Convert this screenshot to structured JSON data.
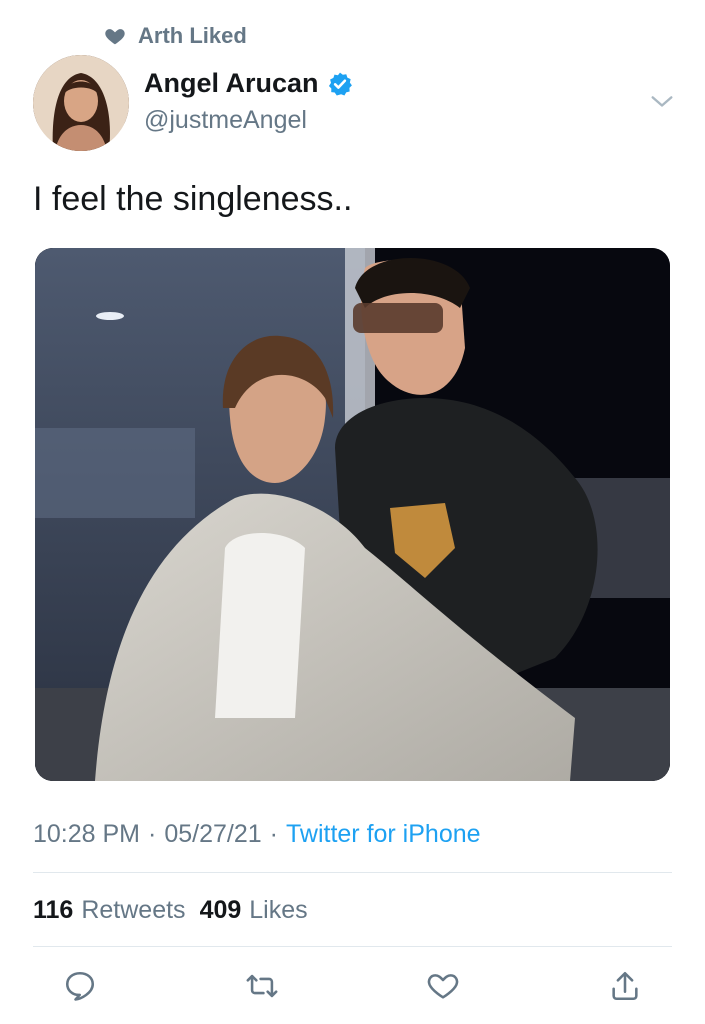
{
  "social_context": {
    "text": "Arth Liked",
    "icon": "heart-icon"
  },
  "author": {
    "name": "Angel Arucan",
    "handle": "@justmeAngel",
    "verified": true
  },
  "tweet": {
    "text": "I feel the singleness.."
  },
  "meta": {
    "time": "10:28 PM",
    "separator": "·",
    "date": "05/27/21",
    "source": "Twitter for iPhone"
  },
  "stats": {
    "retweets_count": "116",
    "retweets_label": "Retweets",
    "likes_count": "409",
    "likes_label": "Likes"
  },
  "actions": [
    "reply-icon",
    "retweet-icon",
    "like-icon",
    "share-icon"
  ],
  "colors": {
    "accent": "#1da1f2",
    "secondary_text": "#657786",
    "primary_text": "#14171a",
    "verified": "#1da1f2"
  }
}
